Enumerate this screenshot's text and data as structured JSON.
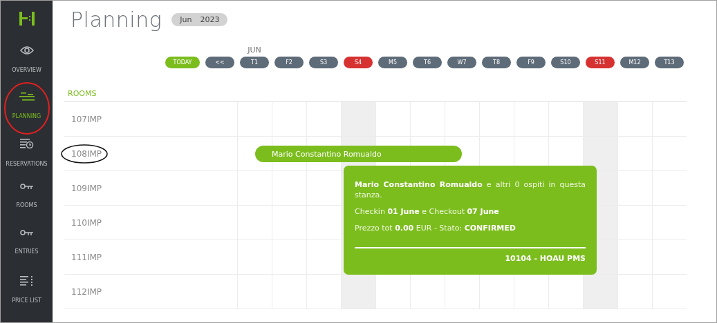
{
  "sidebar": {
    "items": [
      {
        "label": "OVERVIEW",
        "kind": "eye",
        "selected": false
      },
      {
        "label": "PLANNING",
        "kind": "lines",
        "selected": true
      },
      {
        "label": "RESERVATIONS",
        "kind": "list-clock",
        "selected": false
      },
      {
        "label": "ROOMS",
        "kind": "key",
        "selected": false
      },
      {
        "label": "ENTRIES",
        "kind": "key",
        "selected": false
      },
      {
        "label": "PRICE LIST",
        "kind": "list-dots",
        "selected": false
      }
    ]
  },
  "header": {
    "title": "Planning",
    "month": "Jun",
    "year": "2023"
  },
  "calendar": {
    "month_label": "JUN",
    "today_button": "TODAY",
    "back_button": "<<",
    "days": [
      {
        "label": "T1",
        "weekend": false
      },
      {
        "label": "F2",
        "weekend": false
      },
      {
        "label": "S3",
        "weekend": false
      },
      {
        "label": "S4",
        "weekend": true
      },
      {
        "label": "M5",
        "weekend": false
      },
      {
        "label": "T6",
        "weekend": false
      },
      {
        "label": "W7",
        "weekend": false
      },
      {
        "label": "T8",
        "weekend": false
      },
      {
        "label": "F9",
        "weekend": false
      },
      {
        "label": "S10",
        "weekend": false
      },
      {
        "label": "S11",
        "weekend": true
      },
      {
        "label": "M12",
        "weekend": false
      },
      {
        "label": "T13",
        "weekend": false
      }
    ]
  },
  "rooms_heading": "ROOMS",
  "rooms": [
    {
      "name": "107IMP"
    },
    {
      "name": "108IMP",
      "booking": {
        "guest": "Mario Constantino Romualdo"
      }
    },
    {
      "name": "109IMP"
    },
    {
      "name": "110IMP"
    },
    {
      "name": "111IMP"
    },
    {
      "name": "112IMP"
    }
  ],
  "tooltip": {
    "lines": [
      "**Mario Constantino Romualdo** e altri 0 ospiti in questa stanza.",
      "Checkin **01 June** e Checkout **07 June**",
      "Prezzo tot **0.00** EUR - Stato: **CONFIRMED**"
    ],
    "footer": "10104 - HOAU PMS"
  }
}
